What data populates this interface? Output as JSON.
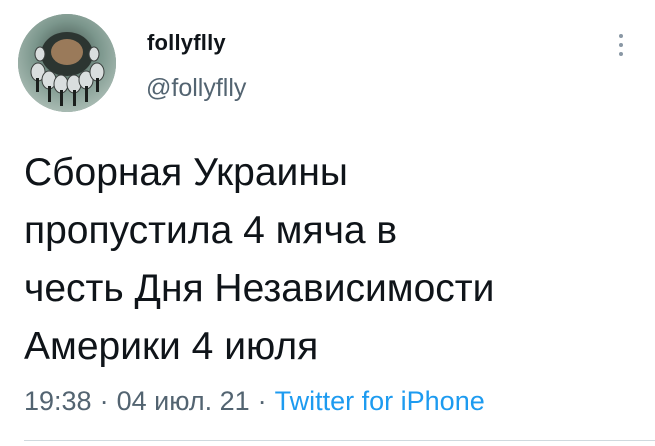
{
  "user": {
    "display_name": "follyflly",
    "handle": "@follyflly"
  },
  "tweet": {
    "text": "Сборная Украины\nпропустила 4 мяча в\nчесть Дня Независимости\nАмерики 4 июля",
    "time": "19:38",
    "separator_1": "·",
    "date": "04 июл. 21",
    "separator_2": "·",
    "source": "Twitter for iPhone"
  },
  "icons": {
    "more": "more-vertical-icon"
  },
  "colors": {
    "text": "#0f1419",
    "secondary": "#536471",
    "link": "#1d9bf0",
    "divider": "#cfd9de"
  }
}
